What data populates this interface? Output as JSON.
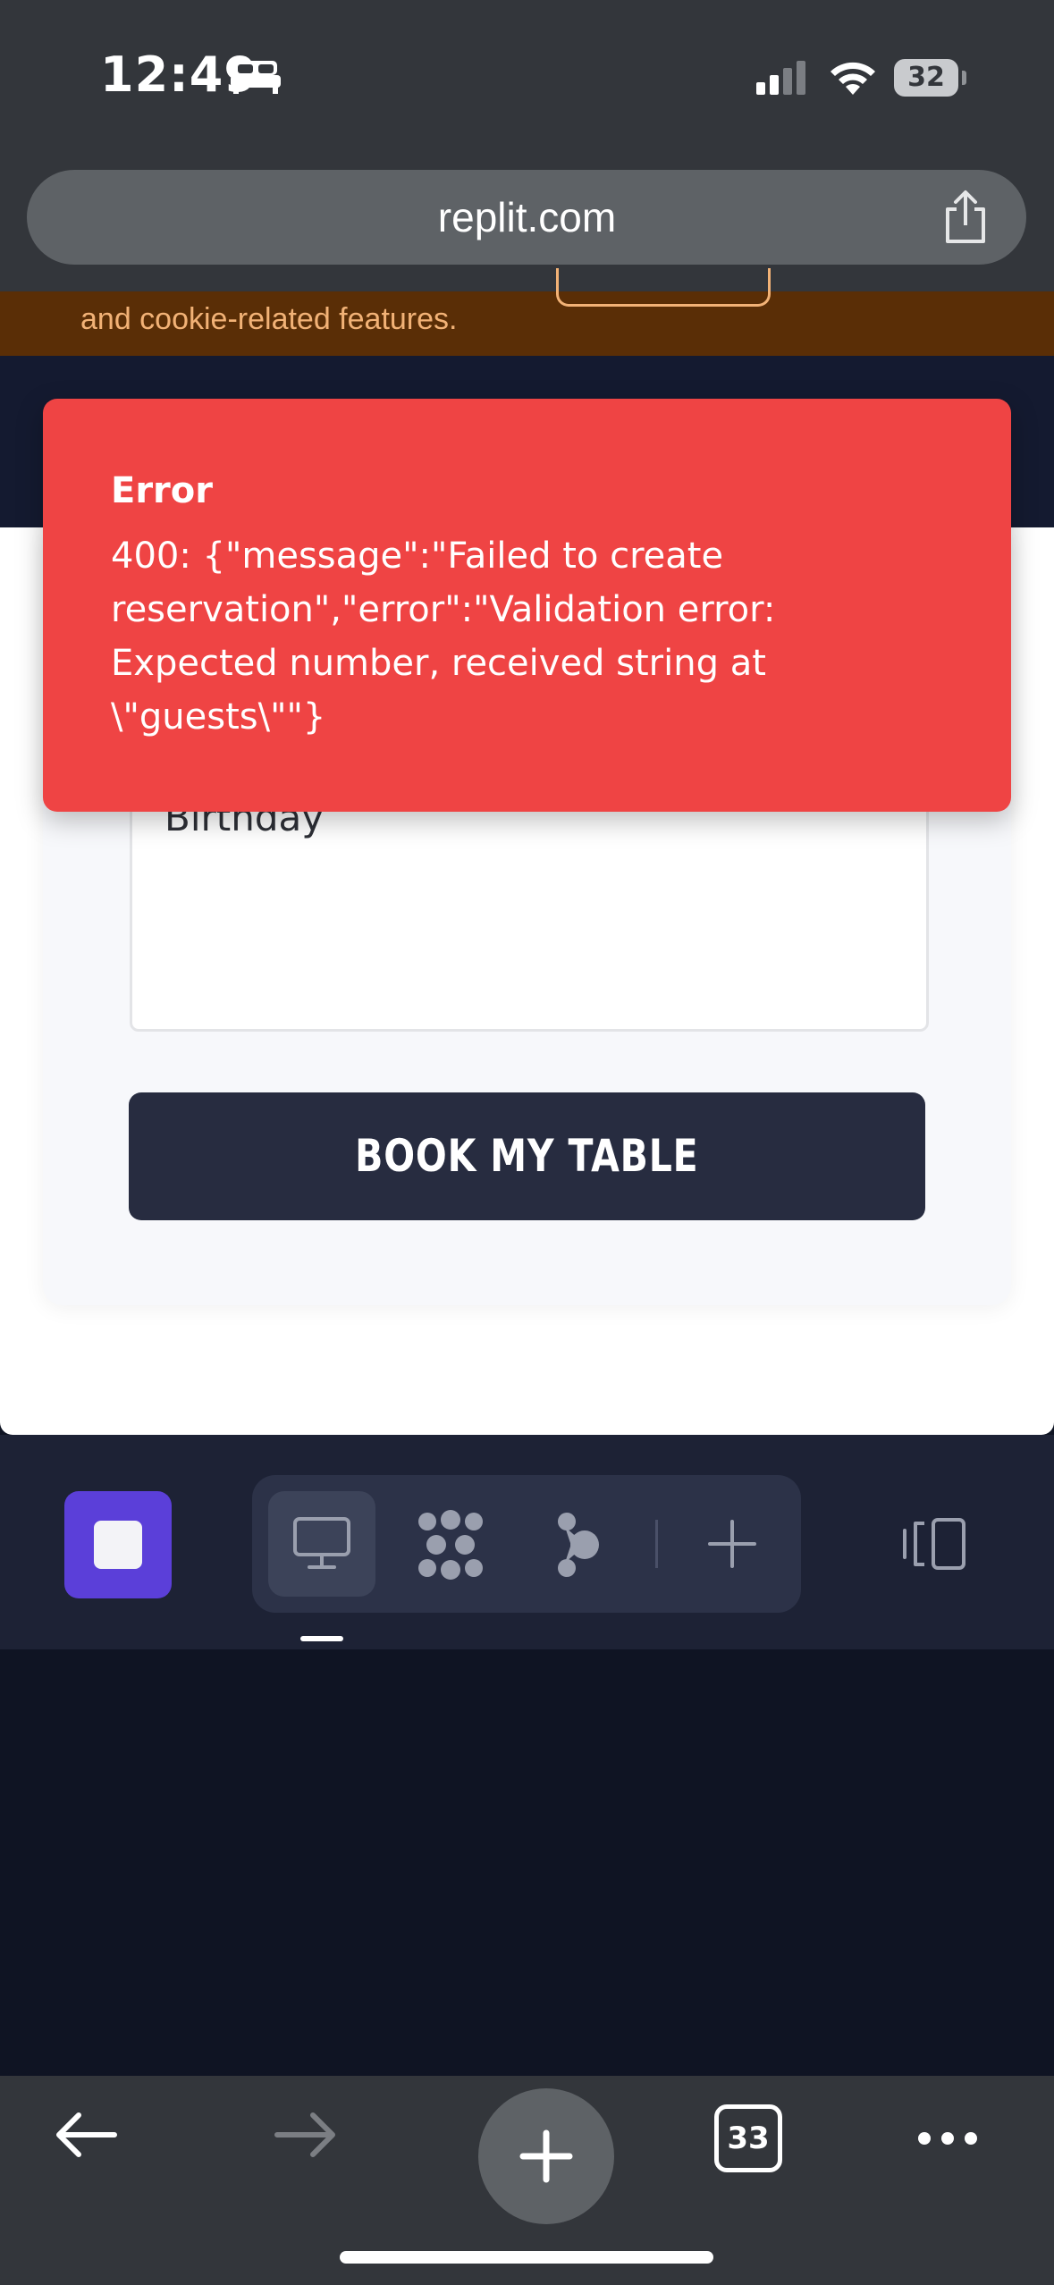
{
  "status_bar": {
    "time": "12:49",
    "battery": "32",
    "icons": [
      "bed-icon",
      "cellular-signal-icon",
      "wifi-icon",
      "battery-icon"
    ]
  },
  "browser": {
    "url": "replit.com",
    "tabs_count": "33",
    "icons": [
      "share-icon",
      "back-arrow-icon",
      "forward-arrow-icon",
      "new-tab-plus-icon",
      "more-icon"
    ]
  },
  "cookie_banner": {
    "text": "and cookie-related features."
  },
  "form": {
    "special_requests_value": "Birthday",
    "submit_label": "BOOK MY TABLE"
  },
  "toast": {
    "title": "Error",
    "message": "400: {\"message\":\"Failed to create\nreservation\",\"error\":\"Validation error:\nExpected number, received string at\n\\\"guests\\\"\"}"
  },
  "dev_toolbar": {
    "icons": [
      "stop-icon",
      "monitor-icon",
      "cluster-icon",
      "agent-icon",
      "add-icon",
      "device-toggle-icon"
    ]
  },
  "colors": {
    "toast_bg": "#ef4444",
    "button_bg": "#272c40",
    "stop_button": "#5b3fd9",
    "cookie_banner": "#5a2e06"
  }
}
